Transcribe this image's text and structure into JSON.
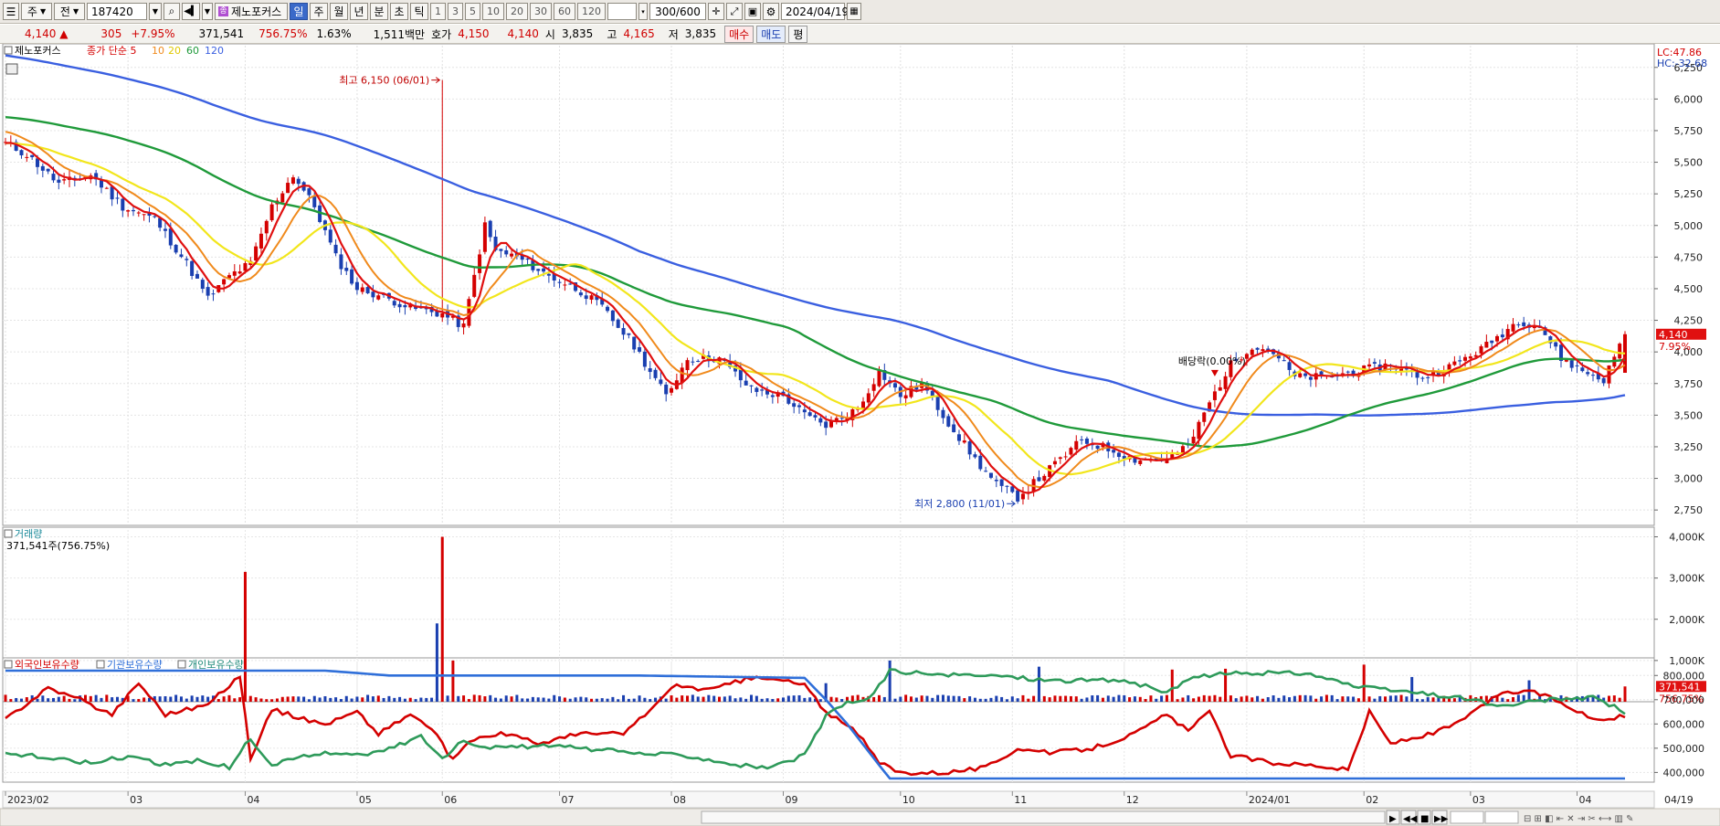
{
  "toolbar": {
    "period_type": "주",
    "market": "전",
    "code": "187420",
    "name": "제노포커스",
    "timeframes": [
      "일",
      "주",
      "월",
      "년",
      "분",
      "초",
      "틱"
    ],
    "selected_timeframe": "일",
    "minutes": [
      "1",
      "3",
      "5",
      "10",
      "20",
      "30",
      "60",
      "120"
    ],
    "count": "300/600",
    "date": "2024/04/19"
  },
  "info": {
    "price": "4,140",
    "change": "305",
    "change_pct": "+7.95%",
    "volume": "371,541",
    "volume_ratio": "756.75%",
    "turnover": "1.63%",
    "amount": "1,511백만",
    "ask_label": "호가",
    "ask1": "4,150",
    "ask2": "4,140",
    "open_label": "시",
    "open": "3,835",
    "high_label": "고",
    "high": "4,165",
    "low_label": "저",
    "low": "3,835",
    "buy": "매수",
    "sell": "매도",
    "eval": "평"
  },
  "colors": {
    "ma5": "#e01010",
    "ma10": "#f08a1c",
    "ma20": "#f2e61c",
    "ma60": "#1f9a3a",
    "ma120": "#3a5fe0",
    "up": "#d40000",
    "down": "#1a3fb0",
    "foreign": "#d40000",
    "institution": "#2f6fd9",
    "individual": "#2e9a5a"
  },
  "chart_data": [
    {
      "type": "line",
      "title": "",
      "legend": {
        "name": "제노포커스",
        "prefix": "종가 단순",
        "periods": [
          "5",
          "10",
          "20",
          "60",
          "120"
        ]
      },
      "ylim": [
        2650,
        6400
      ],
      "y_ticks": [
        "6,250",
        "6,000",
        "5,750",
        "5,500",
        "5,250",
        "5,000",
        "4,750",
        "4,500",
        "4,250",
        "4,000",
        "3,750",
        "3,500",
        "3,250",
        "3,000",
        "2,750"
      ],
      "y_tick_values": [
        6250,
        6000,
        5750,
        5500,
        5250,
        5000,
        4750,
        4500,
        4250,
        4000,
        3750,
        3500,
        3250,
        3000,
        2750
      ],
      "right_top_labels": [
        "LC:47.86",
        "HC:-32.68"
      ],
      "last_price_label": "4,140",
      "last_change_label": "7.95%",
      "annotations": {
        "high": {
          "text": "최고 6,150 (06/01)",
          "month": "06",
          "value": 6150
        },
        "low": {
          "text": "최저 2,800 (11/01)",
          "month": "11",
          "value": 2800
        },
        "dividend": {
          "text": "배당락(0.00%)"
        }
      },
      "x_ticks": [
        "2023/02",
        "03",
        "04",
        "05",
        "06",
        "07",
        "08",
        "09",
        "10",
        "11",
        "12",
        "2024/01",
        "02",
        "03",
        "04"
      ],
      "x_last": "04/19",
      "anchors": [
        [
          0,
          5650
        ],
        [
          4,
          5560
        ],
        [
          10,
          5330
        ],
        [
          16,
          5400
        ],
        [
          22,
          5150
        ],
        [
          28,
          5050
        ],
        [
          34,
          4700
        ],
        [
          38,
          4420
        ],
        [
          42,
          4600
        ],
        [
          46,
          4700
        ],
        [
          50,
          5150
        ],
        [
          54,
          5400
        ],
        [
          58,
          5150
        ],
        [
          62,
          4750
        ],
        [
          66,
          4500
        ],
        [
          70,
          4450
        ],
        [
          76,
          4350
        ],
        [
          82,
          4300
        ],
        [
          86,
          4200
        ],
        [
          88,
          4600
        ],
        [
          90,
          5000
        ],
        [
          92,
          4800
        ],
        [
          96,
          4750
        ],
        [
          102,
          4600
        ],
        [
          108,
          4480
        ],
        [
          112,
          4350
        ],
        [
          118,
          4050
        ],
        [
          124,
          3650
        ],
        [
          128,
          3950
        ],
        [
          134,
          3950
        ],
        [
          140,
          3700
        ],
        [
          146,
          3650
        ],
        [
          150,
          3500
        ],
        [
          154,
          3420
        ],
        [
          160,
          3550
        ],
        [
          164,
          3850
        ],
        [
          168,
          3650
        ],
        [
          172,
          3750
        ],
        [
          176,
          3500
        ],
        [
          182,
          3150
        ],
        [
          186,
          2950
        ],
        [
          190,
          2850
        ],
        [
          194,
          3000
        ],
        [
          198,
          3150
        ],
        [
          202,
          3300
        ],
        [
          206,
          3250
        ],
        [
          212,
          3150
        ],
        [
          218,
          3150
        ],
        [
          222,
          3250
        ],
        [
          226,
          3600
        ],
        [
          230,
          3900
        ],
        [
          234,
          4050
        ],
        [
          238,
          4000
        ],
        [
          242,
          3800
        ],
        [
          248,
          3800
        ],
        [
          254,
          3850
        ],
        [
          260,
          3900
        ],
        [
          266,
          3800
        ],
        [
          272,
          3900
        ],
        [
          278,
          4050
        ],
        [
          284,
          4250
        ],
        [
          288,
          4200
        ],
        [
          292,
          3950
        ],
        [
          296,
          3850
        ],
        [
          300,
          3780
        ],
        [
          304,
          4140
        ]
      ],
      "ma_start": {
        "ma5": 5650,
        "ma10": 5750,
        "ma20": 5650,
        "ma60": 5860,
        "ma120": 6350
      }
    },
    {
      "type": "bar",
      "title": "거래량",
      "subtitle": "371,541주(756.75%)",
      "ylim": [
        0,
        4100
      ],
      "y_ticks": [
        "4,000K",
        "3,000K",
        "2,000K",
        "1,000K"
      ],
      "y_tick_values": [
        4000,
        3000,
        2000,
        1000
      ],
      "last_value_label": "371,541",
      "last_ratio_label": "756.75%",
      "spikes": [
        [
          45,
          3150
        ],
        [
          81,
          1900
        ],
        [
          82,
          4000
        ],
        [
          84,
          1000
        ],
        [
          154,
          450
        ],
        [
          166,
          1000
        ],
        [
          194,
          850
        ],
        [
          219,
          780
        ],
        [
          229,
          800
        ],
        [
          255,
          900
        ],
        [
          264,
          600
        ],
        [
          286,
          520
        ],
        [
          304,
          371
        ]
      ]
    },
    {
      "type": "line",
      "title": "",
      "legend": [
        "외국인보유수량",
        "기관보유수량",
        "개인보유수량"
      ],
      "ylim": [
        360000,
        850000
      ],
      "y_ticks": [
        "800,000",
        "700,000",
        "600,000",
        "500,000",
        "400,000"
      ],
      "y_tick_values": [
        800000,
        700000,
        600000,
        500000,
        400000
      ],
      "series": [
        {
          "key": "foreign",
          "anchors": [
            [
              0,
              620000
            ],
            [
              8,
              750000
            ],
            [
              14,
              700000
            ],
            [
              20,
              640000
            ],
            [
              25,
              770000
            ],
            [
              30,
              640000
            ],
            [
              38,
              680000
            ],
            [
              44,
              800000
            ],
            [
              46,
              460000
            ],
            [
              50,
              660000
            ],
            [
              56,
              620000
            ],
            [
              60,
              600000
            ],
            [
              66,
              650000
            ],
            [
              70,
              560000
            ],
            [
              76,
              640000
            ],
            [
              80,
              580000
            ],
            [
              84,
              450000
            ],
            [
              88,
              540000
            ],
            [
              94,
              560000
            ],
            [
              100,
              520000
            ],
            [
              108,
              560000
            ],
            [
              116,
              560000
            ],
            [
              120,
              640000
            ],
            [
              126,
              760000
            ],
            [
              132,
              740000
            ],
            [
              140,
              790000
            ],
            [
              146,
              780000
            ],
            [
              150,
              760000
            ],
            [
              154,
              650000
            ],
            [
              160,
              560000
            ],
            [
              164,
              440000
            ],
            [
              168,
              400000
            ],
            [
              176,
              400000
            ],
            [
              184,
              420000
            ],
            [
              190,
              500000
            ],
            [
              196,
              480000
            ],
            [
              204,
              500000
            ],
            [
              212,
              560000
            ],
            [
              218,
              640000
            ],
            [
              222,
              570000
            ],
            [
              226,
              650000
            ],
            [
              230,
              470000
            ],
            [
              238,
              440000
            ],
            [
              246,
              430000
            ],
            [
              252,
              410000
            ],
            [
              256,
              650000
            ],
            [
              260,
              520000
            ],
            [
              268,
              560000
            ],
            [
              274,
              620000
            ],
            [
              280,
              720000
            ],
            [
              286,
              740000
            ],
            [
              292,
              690000
            ],
            [
              298,
              620000
            ],
            [
              304,
              630000
            ]
          ]
        },
        {
          "key": "institution",
          "anchors": [
            [
              0,
              820000
            ],
            [
              60,
              820000
            ],
            [
              72,
              800000
            ],
            [
              118,
              800000
            ],
            [
              150,
              790000
            ],
            [
              154,
              700000
            ],
            [
              158,
              600000
            ],
            [
              164,
              430000
            ],
            [
              166,
              375000
            ],
            [
              304,
              375000
            ]
          ]
        },
        {
          "key": "individual",
          "anchors": [
            [
              0,
              480000
            ],
            [
              8,
              460000
            ],
            [
              16,
              440000
            ],
            [
              24,
              470000
            ],
            [
              30,
              430000
            ],
            [
              36,
              450000
            ],
            [
              42,
              420000
            ],
            [
              46,
              540000
            ],
            [
              50,
              430000
            ],
            [
              56,
              470000
            ],
            [
              62,
              480000
            ],
            [
              70,
              480000
            ],
            [
              78,
              550000
            ],
            [
              82,
              460000
            ],
            [
              86,
              530000
            ],
            [
              92,
              500000
            ],
            [
              100,
              510000
            ],
            [
              108,
              500000
            ],
            [
              118,
              480000
            ],
            [
              128,
              470000
            ],
            [
              138,
              430000
            ],
            [
              144,
              420000
            ],
            [
              150,
              470000
            ],
            [
              154,
              630000
            ],
            [
              158,
              690000
            ],
            [
              162,
              700000
            ],
            [
              166,
              820000
            ],
            [
              176,
              800000
            ],
            [
              186,
              800000
            ],
            [
              196,
              780000
            ],
            [
              210,
              780000
            ],
            [
              218,
              730000
            ],
            [
              224,
              800000
            ],
            [
              232,
              810000
            ],
            [
              244,
              810000
            ],
            [
              248,
              790000
            ],
            [
              254,
              750000
            ],
            [
              260,
              740000
            ],
            [
              268,
              720000
            ],
            [
              276,
              700000
            ],
            [
              280,
              670000
            ],
            [
              290,
              700000
            ],
            [
              298,
              710000
            ],
            [
              304,
              650000
            ]
          ]
        }
      ]
    }
  ]
}
